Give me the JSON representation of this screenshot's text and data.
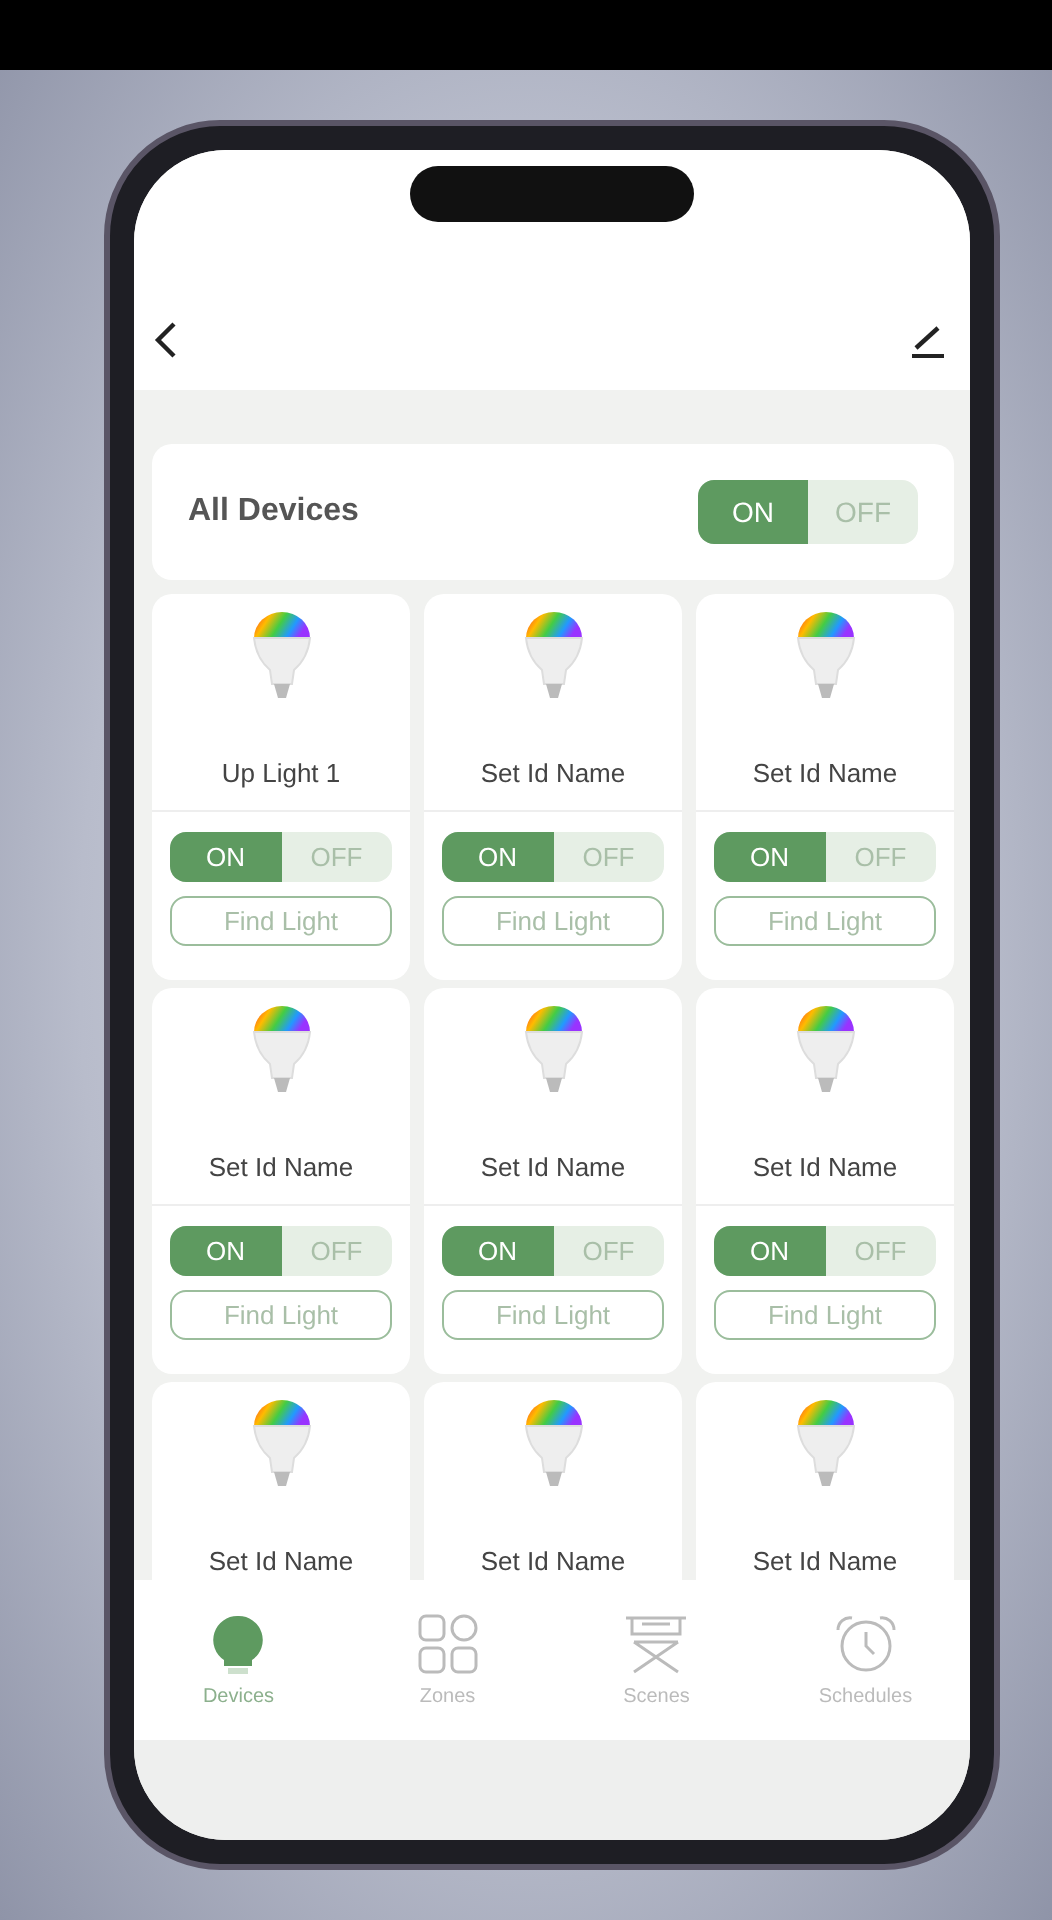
{
  "all_devices": {
    "label": "All Devices",
    "on": true,
    "on_label": "ON",
    "off_label": "OFF"
  },
  "devices": [
    {
      "name": "Up Light 1",
      "on": true,
      "on_label": "ON",
      "off_label": "OFF",
      "find_label": "Find Light"
    },
    {
      "name": "Set Id Name",
      "on": true,
      "on_label": "ON",
      "off_label": "OFF",
      "find_label": "Find Light"
    },
    {
      "name": "Set Id Name",
      "on": true,
      "on_label": "ON",
      "off_label": "OFF",
      "find_label": "Find Light"
    },
    {
      "name": "Set Id Name",
      "on": true,
      "on_label": "ON",
      "off_label": "OFF",
      "find_label": "Find Light"
    },
    {
      "name": "Set Id Name",
      "on": true,
      "on_label": "ON",
      "off_label": "OFF",
      "find_label": "Find Light"
    },
    {
      "name": "Set Id Name",
      "on": true,
      "on_label": "ON",
      "off_label": "OFF",
      "find_label": "Find Light"
    },
    {
      "name": "Set Id Name"
    },
    {
      "name": "Set Id Name"
    },
    {
      "name": "Set Id Name"
    }
  ],
  "tabs": [
    {
      "kind": "bulb",
      "label": "Devices",
      "selected": true
    },
    {
      "kind": "zones",
      "label": "Zones",
      "selected": false
    },
    {
      "kind": "scenes",
      "label": "Scenes",
      "selected": false
    },
    {
      "kind": "alarm",
      "label": "Schedules",
      "selected": false
    }
  ]
}
